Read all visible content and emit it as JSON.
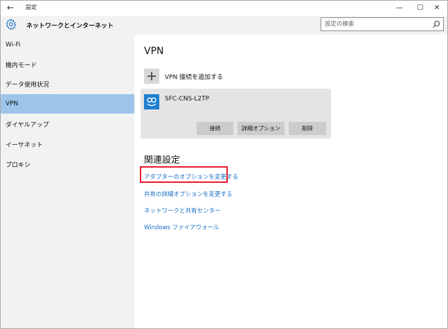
{
  "window": {
    "title": "設定",
    "back_glyph": "←",
    "minimize_glyph": "—",
    "maximize_glyph": "☐",
    "close_glyph": "✕"
  },
  "header": {
    "title": "ネットワークとインターネット",
    "search_placeholder": "設定の検索"
  },
  "sidebar": {
    "items": [
      {
        "label": "Wi-Fi"
      },
      {
        "label": "機内モード"
      },
      {
        "label": "データ使用状況"
      },
      {
        "label": "VPN",
        "selected": true
      },
      {
        "label": "ダイヤルアップ"
      },
      {
        "label": "イーサネット"
      },
      {
        "label": "プロキシ"
      }
    ]
  },
  "main": {
    "heading": "VPN",
    "add_vpn_label": "VPN 接続を追加する",
    "connection": {
      "name": "SFC-CNS-L2TP",
      "connect_label": "接続",
      "advanced_label": "詳細オプション",
      "delete_label": "削除"
    },
    "related": {
      "heading": "関連設定",
      "links": [
        {
          "label": "アダプターのオプションを変更する",
          "highlighted": true
        },
        {
          "label": "共有の詳細オプションを変更する"
        },
        {
          "label": "ネットワークと共有センター"
        },
        {
          "label": "Windows ファイアウォール"
        }
      ]
    }
  },
  "colors": {
    "accent_link": "#1a6fc9",
    "selected_bg": "#9cc5e9",
    "vpn_icon_bg": "#1d7fd0",
    "highlight_border": "#e8192c"
  },
  "icons": {
    "back": "arrow-left-icon",
    "gear": "gear-icon",
    "search": "search-icon",
    "plus": "plus-icon",
    "vpn": "vpn-connection-icon"
  }
}
